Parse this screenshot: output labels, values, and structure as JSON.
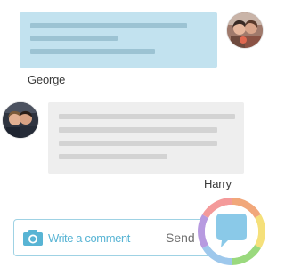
{
  "thread": {
    "messages": [
      {
        "author": "George",
        "side": "right",
        "bubble_color": "#c2e2ef"
      },
      {
        "author": "Harry",
        "side": "left",
        "bubble_color": "#eeeeee"
      }
    ]
  },
  "composer": {
    "placeholder": "Write a comment",
    "send_label": "Send",
    "camera_icon": "camera-icon",
    "accent_color": "#58b4d4"
  },
  "chat_button": {
    "icon": "speech-bubble-icon",
    "ring_colors": [
      "#f1a77a",
      "#f5e07a",
      "#9ad97e",
      "#9ec8ec",
      "#b79ae0",
      "#f49a9a"
    ]
  }
}
